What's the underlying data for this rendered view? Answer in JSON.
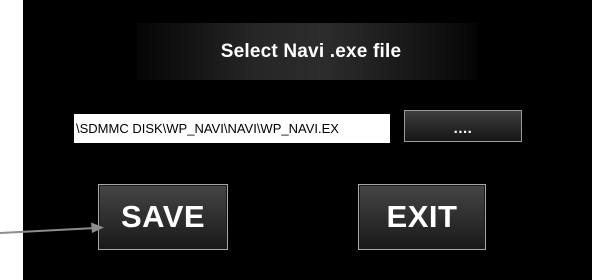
{
  "dialog": {
    "title": "Select Navi .exe file"
  },
  "path_field": {
    "value": "\\SDMMC DISK\\WP_NAVI\\NAVI\\WP_NAVI.EX"
  },
  "buttons": {
    "browse_label": "....",
    "save_label": "SAVE",
    "exit_label": "EXIT"
  },
  "annotation": {
    "icon": "arrow-right-icon",
    "color": "#8c8c8c"
  },
  "colors": {
    "background": "#000000",
    "text": "#ffffff",
    "button_border": "#a8a8a8"
  }
}
